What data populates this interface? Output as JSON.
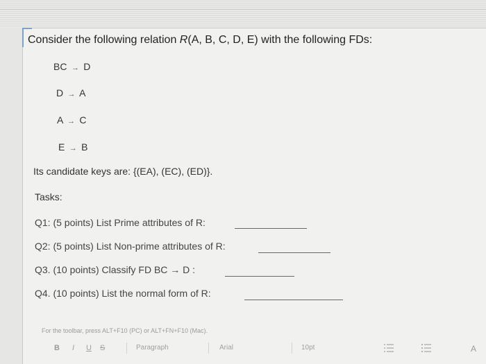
{
  "question": {
    "intro_plain": "Consider the following relation ",
    "intro_relation": "R",
    "intro_args": "(A, B, C, D, E) with the following FDs:"
  },
  "fds": [
    {
      "lhs": "BC",
      "rhs": "D"
    },
    {
      "lhs": "D",
      "rhs": "A"
    },
    {
      "lhs": "A",
      "rhs": "C"
    },
    {
      "lhs": "E",
      "rhs": "B"
    }
  ],
  "candidate_keys": "Its candidate keys are: {(EA), (EC), (ED)}.",
  "tasks_label": "Tasks:",
  "tasks": [
    {
      "text": "Q1: (5 points) List Prime attributes of R:"
    },
    {
      "text": "Q2: (5 points) List Non-prime attributes of R:"
    },
    {
      "text": "Q3. (10 points) Classify FD  BC → D :"
    },
    {
      "text": "Q4. (10 points) List the normal form of R:"
    }
  ],
  "editor": {
    "hint": "For the toolbar, press ALT+F10 (PC) or ALT+FN+F10 (Mac).",
    "bold": "B",
    "italic": "I",
    "underline": "U",
    "strike": "S",
    "paragraph": "Paragraph",
    "font": "Arial",
    "size": "10pt",
    "color_glyph": "A"
  },
  "colors": {
    "accent": "#7fa0c8"
  },
  "icons": [
    "list-icon",
    "numbered-list-icon",
    "text-color-icon",
    "arrow-icon"
  ]
}
